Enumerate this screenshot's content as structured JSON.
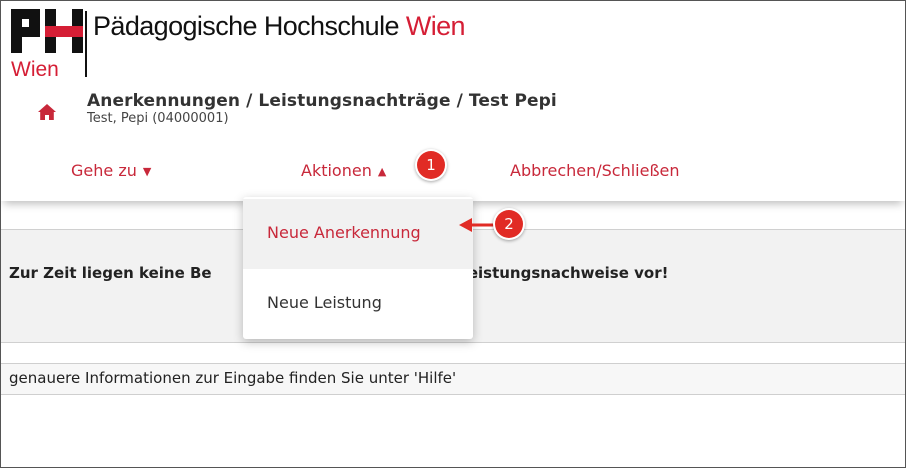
{
  "brand": {
    "logo_letters": "PH",
    "logo_city": "Wien",
    "school_name_main": "Pädagogische Hochschule",
    "school_name_accent": "Wien",
    "accent_color": "#d51e35"
  },
  "header": {
    "home_icon": "home-icon",
    "title": "Anerkennungen / Leistungsnachträge  / Test Pepi",
    "subtitle": "Test, Pepi (04000001)"
  },
  "menu": {
    "goto_label": "Gehe zu",
    "actions_label": "Aktionen",
    "cancel_label": "Abbrechen/Schließen",
    "link_color": "#c8283a"
  },
  "dropdown": {
    "items": [
      {
        "label": "Neue Anerkennung"
      },
      {
        "label": "Neue Leistung"
      }
    ]
  },
  "annotations": {
    "step1": "1",
    "step2": "2",
    "badge_color": "#e12b25"
  },
  "content": {
    "message_left": "Zur Zeit liegen keine Be",
    "message_right": "e/Leistungsnachweise vor!",
    "info": "genauere Informationen zur Eingabe finden Sie unter 'Hilfe'"
  }
}
